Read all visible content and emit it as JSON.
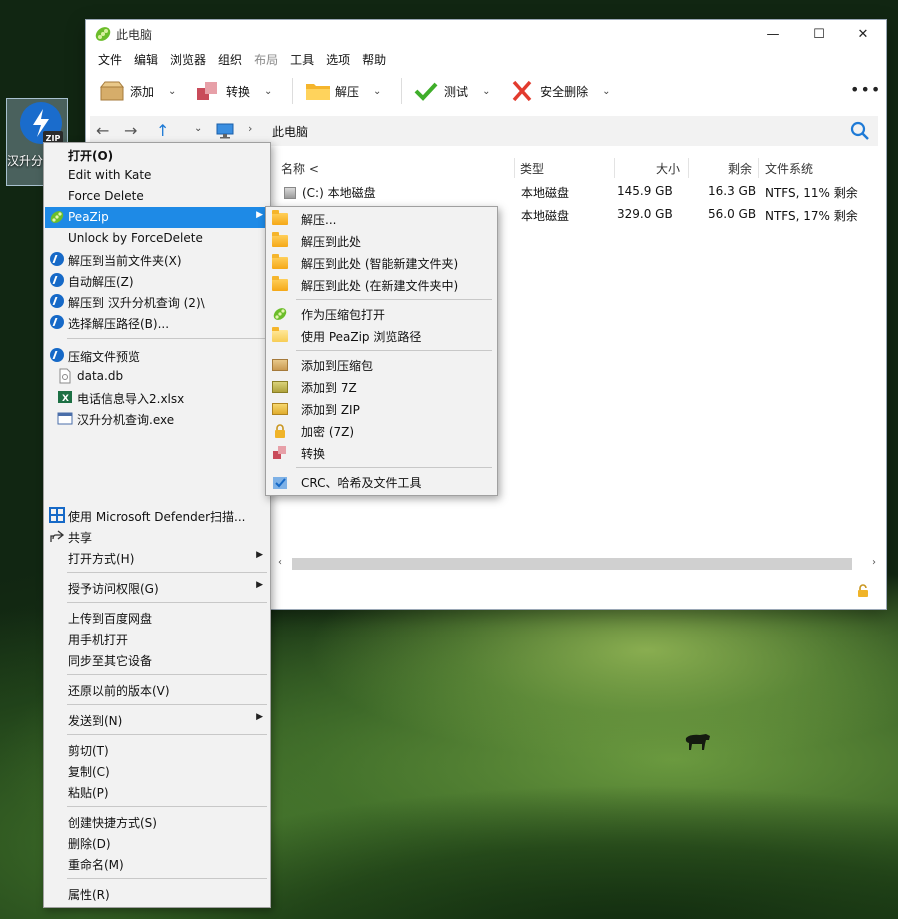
{
  "desktop": {
    "icon_label": "汉升分机查询"
  },
  "window": {
    "title": "此电脑",
    "controls": {
      "minimize": "—",
      "maximize": "☐",
      "close": "✕"
    },
    "menu": [
      "文件",
      "编辑",
      "浏览器",
      "组织",
      "布局",
      "工具",
      "选项",
      "帮助"
    ],
    "menu_disabled_index": 4,
    "toolbar": {
      "add": "添加",
      "convert": "转换",
      "extract": "解压",
      "test": "测试",
      "secure_delete": "安全删除",
      "more": "•••"
    },
    "address": {
      "back": "←",
      "forward": "→",
      "up": "↑",
      "dropdown": "⌄",
      "chevron": "›",
      "path": "此电脑"
    },
    "columns": {
      "name": "名称 <",
      "type": "类型",
      "size": "大小",
      "free": "剩余",
      "fs": "文件系统"
    },
    "rows": [
      {
        "name": "(C:) 本地磁盘",
        "type": "本地磁盘",
        "size": "145.9 GB",
        "free": "16.3 GB",
        "fs": "NTFS, 11% 剩余"
      },
      {
        "name": "",
        "type": "本地磁盘",
        "size": "329.0 GB",
        "free": "56.0 GB",
        "fs": "NTFS, 17% 剩余"
      }
    ],
    "scroll": {
      "left": "‹",
      "right": "›"
    }
  },
  "context_menu": {
    "items": [
      {
        "label": "打开(O)",
        "bold": true
      },
      {
        "label": "Edit with Kate"
      },
      {
        "label": "Force Delete"
      },
      {
        "label": "PeaZip",
        "selected": true,
        "submenu": true
      },
      {
        "label": "Unlock by ForceDelete"
      },
      {
        "label": "解压到当前文件夹(X)"
      },
      {
        "label": "自动解压(Z)"
      },
      {
        "label": "解压到 汉升分机查询 (2)\\"
      },
      {
        "label": "选择解压路径(B)..."
      },
      {
        "label": "压缩文件预览"
      },
      {
        "label": "data.db"
      },
      {
        "label": "电话信息导入2.xlsx"
      },
      {
        "label": "汉升分机查询.exe"
      },
      {
        "label": "使用 Microsoft Defender扫描..."
      },
      {
        "label": "共享"
      },
      {
        "label": "打开方式(H)",
        "submenu": true
      },
      {
        "label": "授予访问权限(G)",
        "submenu": true
      },
      {
        "label": "上传到百度网盘"
      },
      {
        "label": "用手机打开"
      },
      {
        "label": "同步至其它设备"
      },
      {
        "label": "还原以前的版本(V)"
      },
      {
        "label": "发送到(N)",
        "submenu": true
      },
      {
        "label": "剪切(T)"
      },
      {
        "label": "复制(C)"
      },
      {
        "label": "粘贴(P)"
      },
      {
        "label": "创建快捷方式(S)"
      },
      {
        "label": "删除(D)"
      },
      {
        "label": "重命名(M)"
      },
      {
        "label": "属性(R)"
      }
    ],
    "submenu_arrow": "▶"
  },
  "peazip_menu": {
    "items": [
      {
        "label": "解压..."
      },
      {
        "label": "解压到此处"
      },
      {
        "label": "解压到此处 (智能新建文件夹)"
      },
      {
        "label": "解压到此处 (在新建文件夹中)"
      },
      {
        "label": "作为压缩包打开"
      },
      {
        "label": "使用 PeaZip 浏览路径"
      },
      {
        "label": "添加到压缩包"
      },
      {
        "label": "添加到 7Z"
      },
      {
        "label": "添加到 ZIP"
      },
      {
        "label": "加密 (7Z)"
      },
      {
        "label": "转换"
      },
      {
        "label": "CRC、哈希及文件工具"
      }
    ]
  },
  "colors": {
    "selection": "#1e8ae6",
    "accent_blue": "#1e7ad6",
    "peazip_green": "#6bbd2a",
    "delete_red": "#e23b2e",
    "check_green": "#3fae2a"
  }
}
